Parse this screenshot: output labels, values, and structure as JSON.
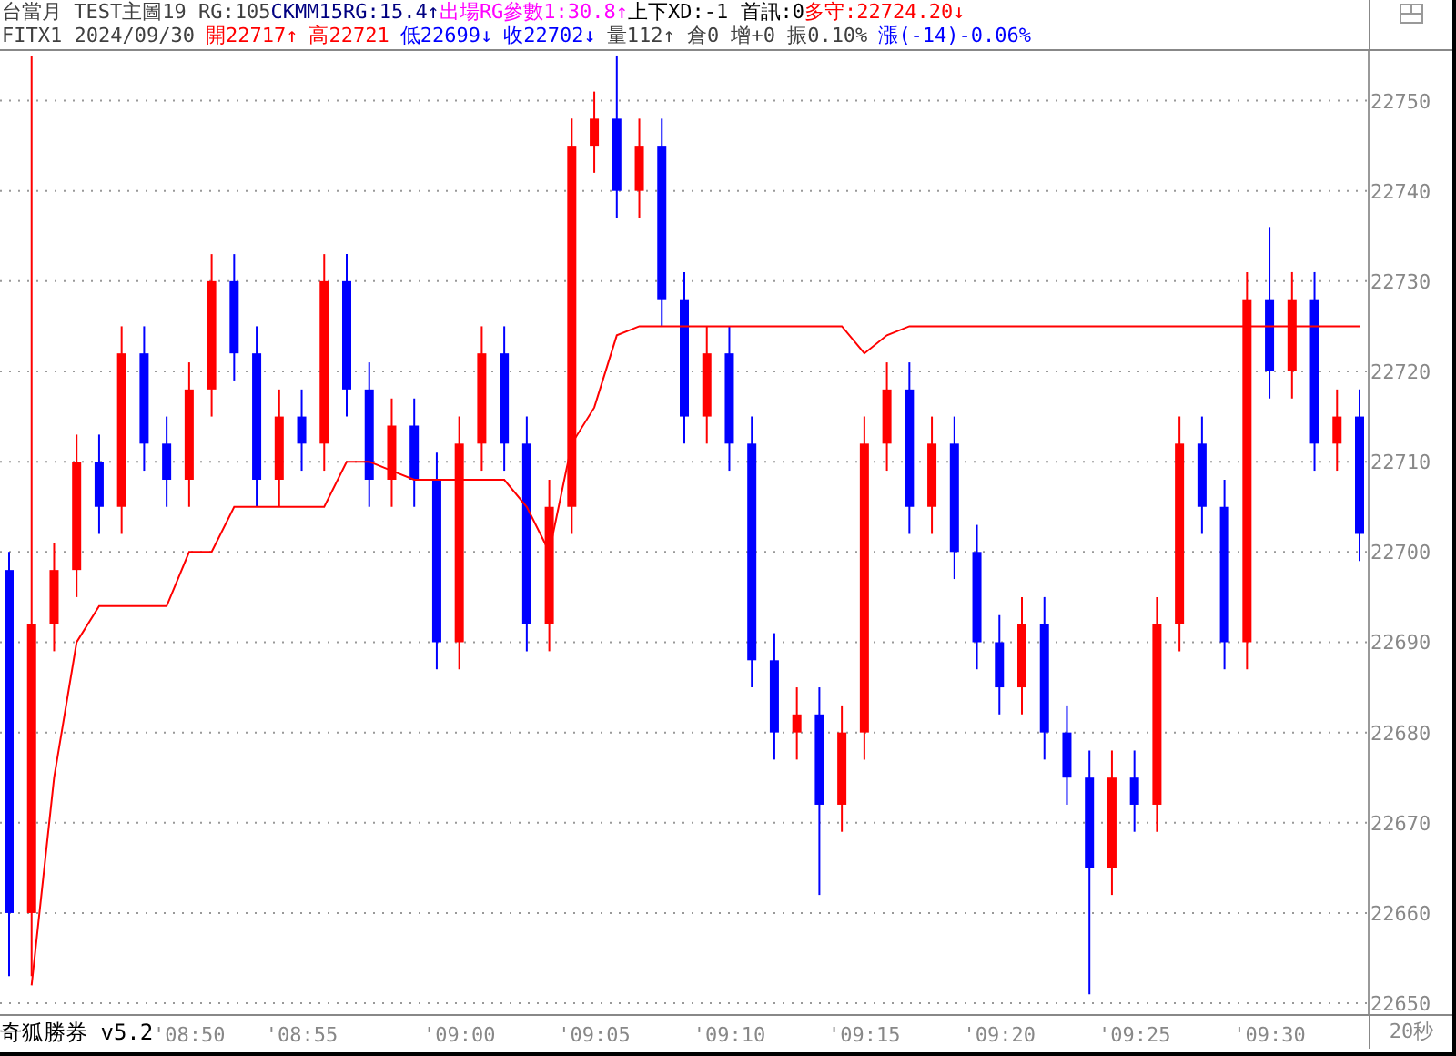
{
  "header": {
    "lines": [
      [
        {
          "text": "台當月 TEST主圖19 RG:105",
          "color": "#404040"
        },
        {
          "text": "CKMM15RG:15.4↑",
          "color": "#000080"
        },
        {
          "text": "出場RG參數1:30.8↑",
          "color": "#ff00ff"
        },
        {
          "text": "上下XD:-1 首訊:0",
          "color": "#000000"
        },
        {
          "text": "多守:22724.20↓",
          "color": "#ff0000"
        }
      ],
      [
        {
          "text": "FITX1 2024/09/30",
          "color": "#404040"
        },
        {
          "text": "開22717↑",
          "color": "#ff0000"
        },
        {
          "text": "高22721",
          "color": "#ff0000"
        },
        {
          "text": "低22699↓",
          "color": "#0000ff"
        },
        {
          "text": "收22702↓",
          "color": "#0000ff"
        },
        {
          "text": "量112↑ 倉0 增+0 振0.10%",
          "color": "#404040"
        },
        {
          "text": "漲(-14)-0.06%",
          "color": "#0000ff"
        }
      ]
    ]
  },
  "chart": {
    "chart_data": {
      "type": "candlestick",
      "grid": true,
      "ylim": [
        22648.8,
        22755.5
      ],
      "yticks": [
        22650,
        22660,
        22670,
        22680,
        22690,
        22700,
        22710,
        22720,
        22730,
        22740,
        22750
      ],
      "categories": [
        null,
        null,
        null,
        null,
        null,
        null,
        null,
        null,
        "'08:50",
        null,
        null,
        null,
        null,
        "'08:55",
        null,
        null,
        null,
        null,
        null,
        null,
        "'09:00",
        null,
        null,
        null,
        null,
        null,
        "'09:05",
        null,
        null,
        null,
        null,
        null,
        "'09:10",
        null,
        null,
        null,
        null,
        null,
        "'09:15",
        null,
        null,
        null,
        null,
        null,
        "'09:20",
        null,
        null,
        null,
        null,
        null,
        "'09:25",
        null,
        null,
        null,
        null,
        null,
        "'09:30",
        null,
        null,
        null,
        null
      ],
      "ohlc": [
        [
          22698,
          22700,
          22653,
          22660
        ],
        [
          22660,
          22755,
          22653,
          22692
        ],
        [
          22692,
          22701,
          22689,
          22698
        ],
        [
          22698,
          22713,
          22695,
          22710
        ],
        [
          22710,
          22713,
          22702,
          22705
        ],
        [
          22705,
          22725,
          22702,
          22722
        ],
        [
          22722,
          22725,
          22709,
          22712
        ],
        [
          22712,
          22715,
          22705,
          22708
        ],
        [
          22708,
          22721,
          22705,
          22718
        ],
        [
          22718,
          22733,
          22715,
          22730
        ],
        [
          22730,
          22733,
          22719,
          22722
        ],
        [
          22722,
          22725,
          22705,
          22708
        ],
        [
          22708,
          22718,
          22705,
          22715
        ],
        [
          22715,
          22718,
          22709,
          22712
        ],
        [
          22712,
          22733,
          22709,
          22730
        ],
        [
          22730,
          22733,
          22715,
          22718
        ],
        [
          22718,
          22721,
          22705,
          22708
        ],
        [
          22708,
          22717,
          22705,
          22714
        ],
        [
          22714,
          22717,
          22705,
          22708
        ],
        [
          22708,
          22711,
          22687,
          22690
        ],
        [
          22690,
          22715,
          22687,
          22712
        ],
        [
          22712,
          22725,
          22709,
          22722
        ],
        [
          22722,
          22725,
          22709,
          22712
        ],
        [
          22712,
          22715,
          22689,
          22692
        ],
        [
          22692,
          22708,
          22689,
          22705
        ],
        [
          22705,
          22748,
          22702,
          22745
        ],
        [
          22745,
          22751,
          22742,
          22748
        ],
        [
          22748,
          22755,
          22737,
          22740
        ],
        [
          22740,
          22748,
          22737,
          22745
        ],
        [
          22745,
          22748,
          22725,
          22728
        ],
        [
          22728,
          22731,
          22712,
          22715
        ],
        [
          22715,
          22725,
          22712,
          22722
        ],
        [
          22722,
          22725,
          22709,
          22712
        ],
        [
          22712,
          22715,
          22685,
          22688
        ],
        [
          22688,
          22691,
          22677,
          22680
        ],
        [
          22680,
          22685,
          22677,
          22682
        ],
        [
          22682,
          22685,
          22662,
          22672
        ],
        [
          22672,
          22683,
          22669,
          22680
        ],
        [
          22680,
          22715,
          22677,
          22712
        ],
        [
          22712,
          22721,
          22709,
          22718
        ],
        [
          22718,
          22721,
          22702,
          22705
        ],
        [
          22705,
          22715,
          22702,
          22712
        ],
        [
          22712,
          22715,
          22697,
          22700
        ],
        [
          22700,
          22703,
          22687,
          22690
        ],
        [
          22690,
          22693,
          22682,
          22685
        ],
        [
          22685,
          22695,
          22682,
          22692
        ],
        [
          22692,
          22695,
          22677,
          22680
        ],
        [
          22680,
          22683,
          22672,
          22675
        ],
        [
          22675,
          22678,
          22651,
          22665
        ],
        [
          22665,
          22678,
          22662,
          22675
        ],
        [
          22675,
          22678,
          22669,
          22672
        ],
        [
          22672,
          22695,
          22669,
          22692
        ],
        [
          22692,
          22715,
          22689,
          22712
        ],
        [
          22712,
          22715,
          22702,
          22705
        ],
        [
          22705,
          22708,
          22687,
          22690
        ],
        [
          22690,
          22731,
          22687,
          22728
        ],
        [
          22728,
          22736,
          22717,
          22720
        ],
        [
          22720,
          22731,
          22717,
          22728
        ],
        [
          22728,
          22731,
          22709,
          22712
        ],
        [
          22712,
          22718,
          22709,
          22715
        ],
        [
          22715,
          22718,
          22699,
          22702
        ]
      ],
      "series": [
        {
          "type": "line",
          "color": "#ff0000",
          "values": [
            null,
            22652,
            22675,
            22690,
            22694,
            22694,
            22694,
            22694,
            22700,
            22700,
            22705,
            22705,
            22705,
            22705,
            22705,
            22710,
            22710,
            22709,
            22708,
            22708,
            22708,
            22708,
            22708,
            22705,
            22700,
            22712,
            22716,
            22724,
            22725,
            22725,
            22725,
            22725,
            22725,
            22725,
            22725,
            22725,
            22725,
            22725,
            22722,
            22724,
            22725,
            22725,
            22725,
            22725,
            22725,
            22725,
            22725,
            22725,
            22725,
            22725,
            22725,
            22725,
            22725,
            22725,
            22725,
            22725,
            22725,
            22725,
            22725,
            22725,
            22725
          ]
        }
      ]
    }
  },
  "footer": {
    "brand": "奇狐勝券 v5.2",
    "interval": "20秒"
  }
}
